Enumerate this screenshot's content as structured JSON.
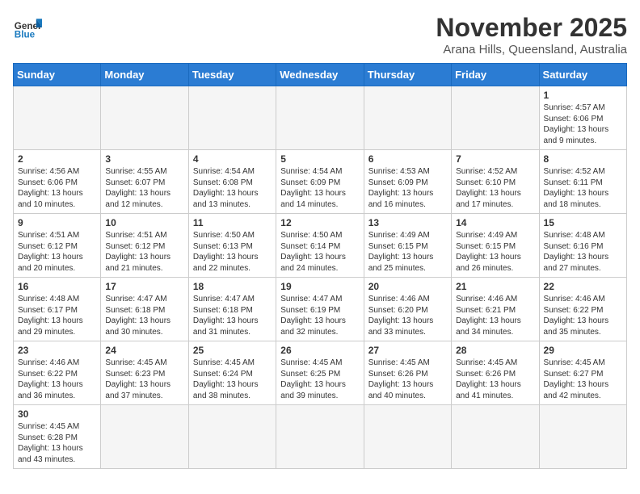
{
  "header": {
    "logo_general": "General",
    "logo_blue": "Blue",
    "month_year": "November 2025",
    "location": "Arana Hills, Queensland, Australia"
  },
  "days_of_week": [
    "Sunday",
    "Monday",
    "Tuesday",
    "Wednesday",
    "Thursday",
    "Friday",
    "Saturday"
  ],
  "weeks": [
    [
      {
        "day": "",
        "info": ""
      },
      {
        "day": "",
        "info": ""
      },
      {
        "day": "",
        "info": ""
      },
      {
        "day": "",
        "info": ""
      },
      {
        "day": "",
        "info": ""
      },
      {
        "day": "",
        "info": ""
      },
      {
        "day": "1",
        "info": "Sunrise: 4:57 AM\nSunset: 6:06 PM\nDaylight: 13 hours and 9 minutes."
      }
    ],
    [
      {
        "day": "2",
        "info": "Sunrise: 4:56 AM\nSunset: 6:06 PM\nDaylight: 13 hours and 10 minutes."
      },
      {
        "day": "3",
        "info": "Sunrise: 4:55 AM\nSunset: 6:07 PM\nDaylight: 13 hours and 12 minutes."
      },
      {
        "day": "4",
        "info": "Sunrise: 4:54 AM\nSunset: 6:08 PM\nDaylight: 13 hours and 13 minutes."
      },
      {
        "day": "5",
        "info": "Sunrise: 4:54 AM\nSunset: 6:09 PM\nDaylight: 13 hours and 14 minutes."
      },
      {
        "day": "6",
        "info": "Sunrise: 4:53 AM\nSunset: 6:09 PM\nDaylight: 13 hours and 16 minutes."
      },
      {
        "day": "7",
        "info": "Sunrise: 4:52 AM\nSunset: 6:10 PM\nDaylight: 13 hours and 17 minutes."
      },
      {
        "day": "8",
        "info": "Sunrise: 4:52 AM\nSunset: 6:11 PM\nDaylight: 13 hours and 18 minutes."
      }
    ],
    [
      {
        "day": "9",
        "info": "Sunrise: 4:51 AM\nSunset: 6:12 PM\nDaylight: 13 hours and 20 minutes."
      },
      {
        "day": "10",
        "info": "Sunrise: 4:51 AM\nSunset: 6:12 PM\nDaylight: 13 hours and 21 minutes."
      },
      {
        "day": "11",
        "info": "Sunrise: 4:50 AM\nSunset: 6:13 PM\nDaylight: 13 hours and 22 minutes."
      },
      {
        "day": "12",
        "info": "Sunrise: 4:50 AM\nSunset: 6:14 PM\nDaylight: 13 hours and 24 minutes."
      },
      {
        "day": "13",
        "info": "Sunrise: 4:49 AM\nSunset: 6:15 PM\nDaylight: 13 hours and 25 minutes."
      },
      {
        "day": "14",
        "info": "Sunrise: 4:49 AM\nSunset: 6:15 PM\nDaylight: 13 hours and 26 minutes."
      },
      {
        "day": "15",
        "info": "Sunrise: 4:48 AM\nSunset: 6:16 PM\nDaylight: 13 hours and 27 minutes."
      }
    ],
    [
      {
        "day": "16",
        "info": "Sunrise: 4:48 AM\nSunset: 6:17 PM\nDaylight: 13 hours and 29 minutes."
      },
      {
        "day": "17",
        "info": "Sunrise: 4:47 AM\nSunset: 6:18 PM\nDaylight: 13 hours and 30 minutes."
      },
      {
        "day": "18",
        "info": "Sunrise: 4:47 AM\nSunset: 6:18 PM\nDaylight: 13 hours and 31 minutes."
      },
      {
        "day": "19",
        "info": "Sunrise: 4:47 AM\nSunset: 6:19 PM\nDaylight: 13 hours and 32 minutes."
      },
      {
        "day": "20",
        "info": "Sunrise: 4:46 AM\nSunset: 6:20 PM\nDaylight: 13 hours and 33 minutes."
      },
      {
        "day": "21",
        "info": "Sunrise: 4:46 AM\nSunset: 6:21 PM\nDaylight: 13 hours and 34 minutes."
      },
      {
        "day": "22",
        "info": "Sunrise: 4:46 AM\nSunset: 6:22 PM\nDaylight: 13 hours and 35 minutes."
      }
    ],
    [
      {
        "day": "23",
        "info": "Sunrise: 4:46 AM\nSunset: 6:22 PM\nDaylight: 13 hours and 36 minutes."
      },
      {
        "day": "24",
        "info": "Sunrise: 4:45 AM\nSunset: 6:23 PM\nDaylight: 13 hours and 37 minutes."
      },
      {
        "day": "25",
        "info": "Sunrise: 4:45 AM\nSunset: 6:24 PM\nDaylight: 13 hours and 38 minutes."
      },
      {
        "day": "26",
        "info": "Sunrise: 4:45 AM\nSunset: 6:25 PM\nDaylight: 13 hours and 39 minutes."
      },
      {
        "day": "27",
        "info": "Sunrise: 4:45 AM\nSunset: 6:26 PM\nDaylight: 13 hours and 40 minutes."
      },
      {
        "day": "28",
        "info": "Sunrise: 4:45 AM\nSunset: 6:26 PM\nDaylight: 13 hours and 41 minutes."
      },
      {
        "day": "29",
        "info": "Sunrise: 4:45 AM\nSunset: 6:27 PM\nDaylight: 13 hours and 42 minutes."
      }
    ],
    [
      {
        "day": "30",
        "info": "Sunrise: 4:45 AM\nSunset: 6:28 PM\nDaylight: 13 hours and 43 minutes."
      },
      {
        "day": "",
        "info": ""
      },
      {
        "day": "",
        "info": ""
      },
      {
        "day": "",
        "info": ""
      },
      {
        "day": "",
        "info": ""
      },
      {
        "day": "",
        "info": ""
      },
      {
        "day": "",
        "info": ""
      }
    ]
  ]
}
